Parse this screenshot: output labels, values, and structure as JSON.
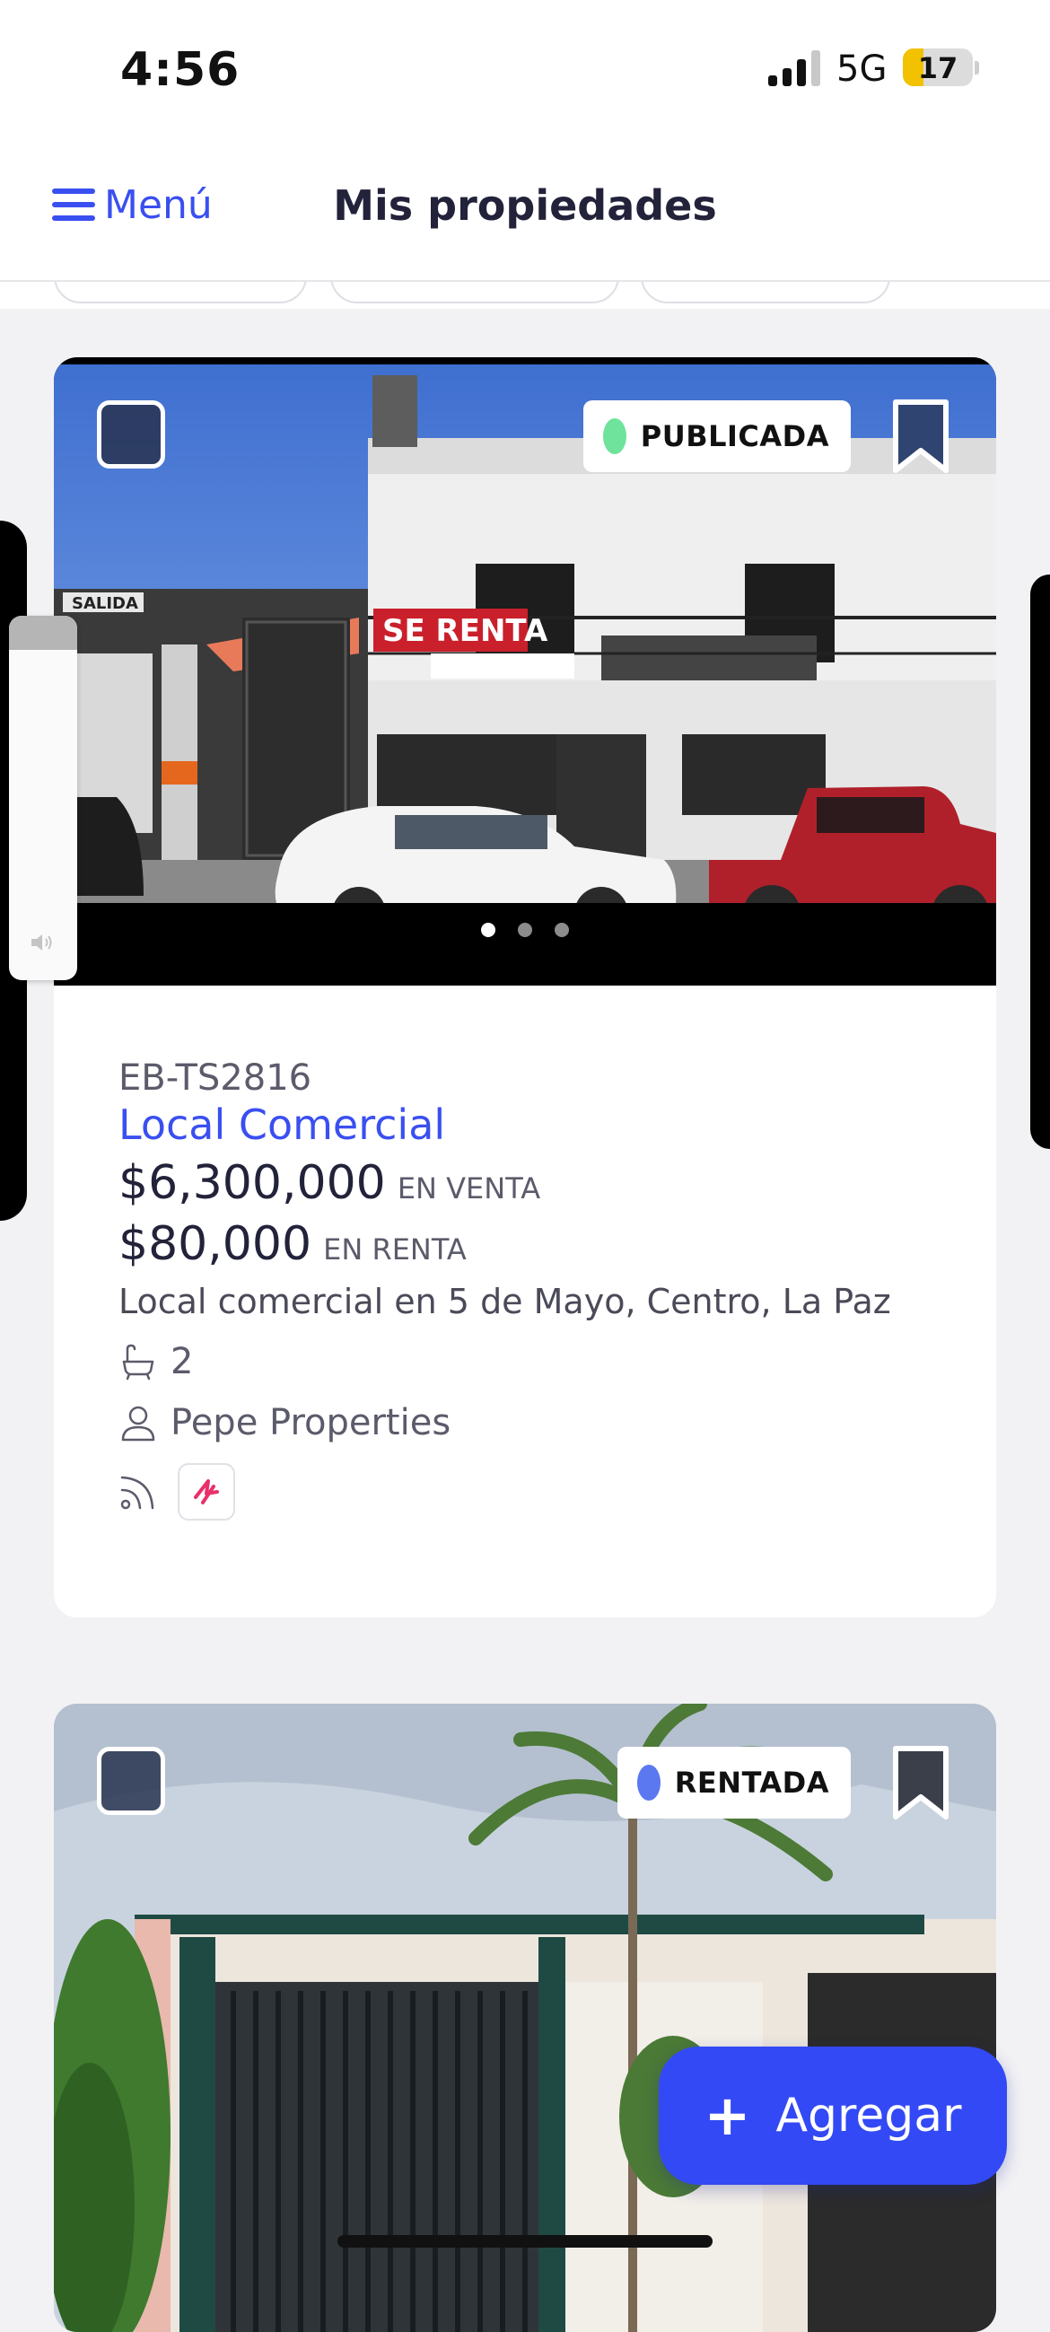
{
  "status_bar": {
    "time": "4:56",
    "network": "5G",
    "battery": "17",
    "battery_color": "#f2c200"
  },
  "nav": {
    "menu_label": "Menú",
    "menu_icon": "hamburger-icon",
    "title": "Mis propiedades"
  },
  "colors": {
    "accent": "#3a4ff0",
    "fab": "#3349f5",
    "published": "#6fe39c",
    "rented": "#5b78f0"
  },
  "listings": [
    {
      "status": "PUBLICADA",
      "status_color": "#6fe39c",
      "code": "EB-TS2816",
      "type": "Local Comercial",
      "prices": [
        {
          "amount": "$6,300,000",
          "label": "EN VENTA"
        },
        {
          "amount": "$80,000",
          "label": "EN RENTA"
        }
      ],
      "description": "Local comercial en 5 de Mayo, Centro, La Paz",
      "bathrooms": "2",
      "agent": "Pepe Properties",
      "photo_sign": "SE RENTA",
      "photo_wall_sign": "SALIDA",
      "photo_count": 3,
      "photo_active_index": 1
    },
    {
      "status": "RENTADA",
      "status_color": "#5b78f0"
    }
  ],
  "fab": {
    "label": "Agregar",
    "icon": "plus-icon"
  }
}
